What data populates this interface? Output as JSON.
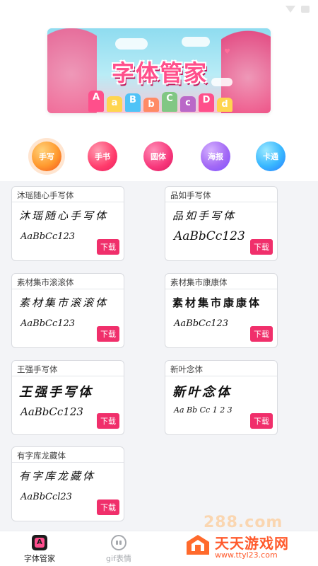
{
  "banner": {
    "title": "字体管家",
    "letters": [
      "A",
      "a",
      "B",
      "b",
      "C",
      "c",
      "D",
      "d"
    ]
  },
  "categories": [
    {
      "label": "手写",
      "color": "#ff9a2f",
      "selected": true
    },
    {
      "label": "手书",
      "color": "#ff3b6b",
      "selected": false
    },
    {
      "label": "圆体",
      "color": "#f7367a",
      "selected": false
    },
    {
      "label": "海报",
      "color": "#a46bf5",
      "selected": false
    },
    {
      "label": "卡通",
      "color": "#39b8ff",
      "selected": false
    }
  ],
  "fonts": [
    {
      "name": "沐瑶随心手写体",
      "preview": "沐瑶随心手写体",
      "sample": "AaBbCc123",
      "button": "下载"
    },
    {
      "name": "品如手写体",
      "preview": "品如手写体",
      "sample": "AaBbCc123",
      "button": "下载"
    },
    {
      "name": "素材集市滚滚体",
      "preview": "素材集市滚滚体",
      "sample": "AaBbCc123",
      "button": "下载"
    },
    {
      "name": "素材集市康康体",
      "preview": "素材集市康康体",
      "sample": "AaBbCc123",
      "button": "下载"
    },
    {
      "name": "王强手写体",
      "preview": "王强手写体",
      "sample": "AaBbCc123",
      "button": "下载"
    },
    {
      "name": "新叶念体",
      "preview": "新叶念体",
      "sample": "Aa Bb Cc 1 2 3",
      "button": "下载"
    },
    {
      "name": "有字库龙藏体",
      "preview": "有字库龙藏体",
      "sample": "AaBbCcl23",
      "button": "下载"
    }
  ],
  "nav": [
    {
      "label": "字体管家",
      "icon": "font-manager-icon",
      "active": true
    },
    {
      "label": "gif表情",
      "icon": "gif-emoji-icon",
      "active": false
    }
  ],
  "watermark": {
    "site_name": "天天游戏网",
    "url": "www.ttyl23.com",
    "faint": "288.com"
  },
  "colors": {
    "accent": "#f02f6b",
    "background": "#f3f4f7",
    "watermark": "#ff5a2c"
  }
}
